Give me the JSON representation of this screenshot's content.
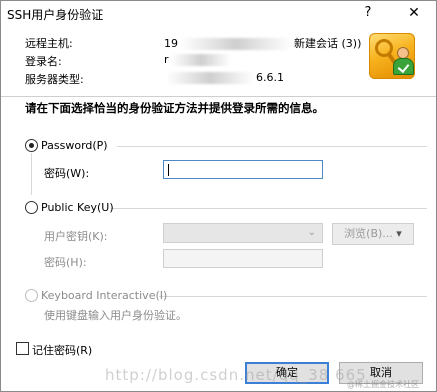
{
  "dialog": {
    "title": "SSH用户身份验证",
    "help_glyph": "?",
    "close_glyph": "✕"
  },
  "info": {
    "host_label": "远程主机:",
    "host_value_start": "19",
    "host_value_end": "新建会话 (3))",
    "user_label": "登录名:",
    "user_value": "r",
    "server_label": "服务器类型:",
    "server_value_end": "6.6.1"
  },
  "instruction": "请在下面选择恰当的身份验证方法并提供登录所需的信息。",
  "password": {
    "option_label": "Password(P)",
    "field_label": "密码(W):"
  },
  "public_key": {
    "option_label": "Public Key(U)",
    "user_key_label": "用户密钥(K):",
    "browse_label": "浏览(B)...",
    "passphrase_label": "密码(H):"
  },
  "keyboard": {
    "option_label": "Keyboard Interactive(I)",
    "description": "使用键盘输入用户身份验证。"
  },
  "remember": {
    "label": "记住密码(R)"
  },
  "buttons": {
    "ok": "确定",
    "cancel": "取消"
  },
  "watermark": {
    "text": "http://blog.csdn.net/qq_38 665",
    "badge": "@稀土掘金技术社区"
  },
  "colors": {
    "accent": "#3c7fd6",
    "disabled_text": "#8c8c8c"
  }
}
